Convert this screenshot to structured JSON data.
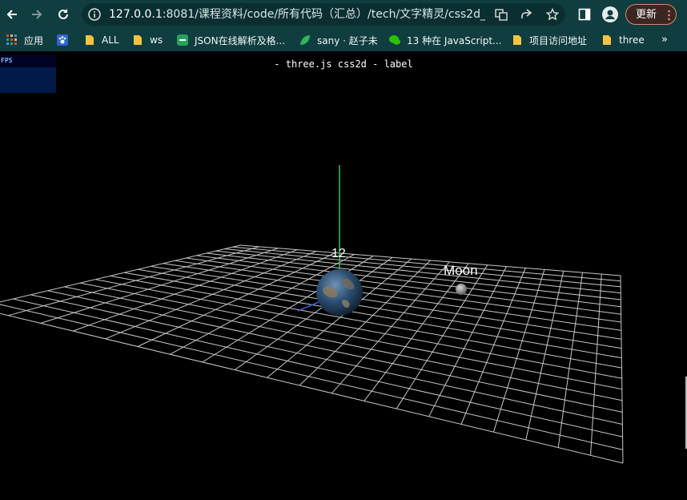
{
  "browser": {
    "url_host": "127.0.0.1",
    "url_rest": ":8081/课程资料/code/所有代码（汇总）/tech/文字精灵/css2d_...",
    "update_label": "更新"
  },
  "bookmarks": [
    {
      "label": "应用",
      "icon": "apps-grid-icon"
    },
    {
      "label": "ALL",
      "icon": "folder-icon"
    },
    {
      "label": "ws",
      "icon": "folder-icon"
    },
    {
      "label": "JSON在线解析及格...",
      "icon": "json-site-icon"
    },
    {
      "label": "sany · 赵子未",
      "icon": "leaf-icon"
    },
    {
      "label": "13 种在 JavaScript...",
      "icon": "wechat-icon"
    },
    {
      "label": "项目访问地址",
      "icon": "folder-icon"
    },
    {
      "label": "three",
      "icon": "folder-icon"
    }
  ],
  "bookmarks_more": "»",
  "stats": {
    "label": "FPS"
  },
  "info_text": "- three.js css2d - label",
  "labels": {
    "earth": "12",
    "moon": "Moon"
  },
  "colors": {
    "toolbar": "#0f3d40",
    "grid": "#c8c8c8",
    "y_axis": "#3cc13c",
    "z_axis": "#3a5fe0"
  }
}
